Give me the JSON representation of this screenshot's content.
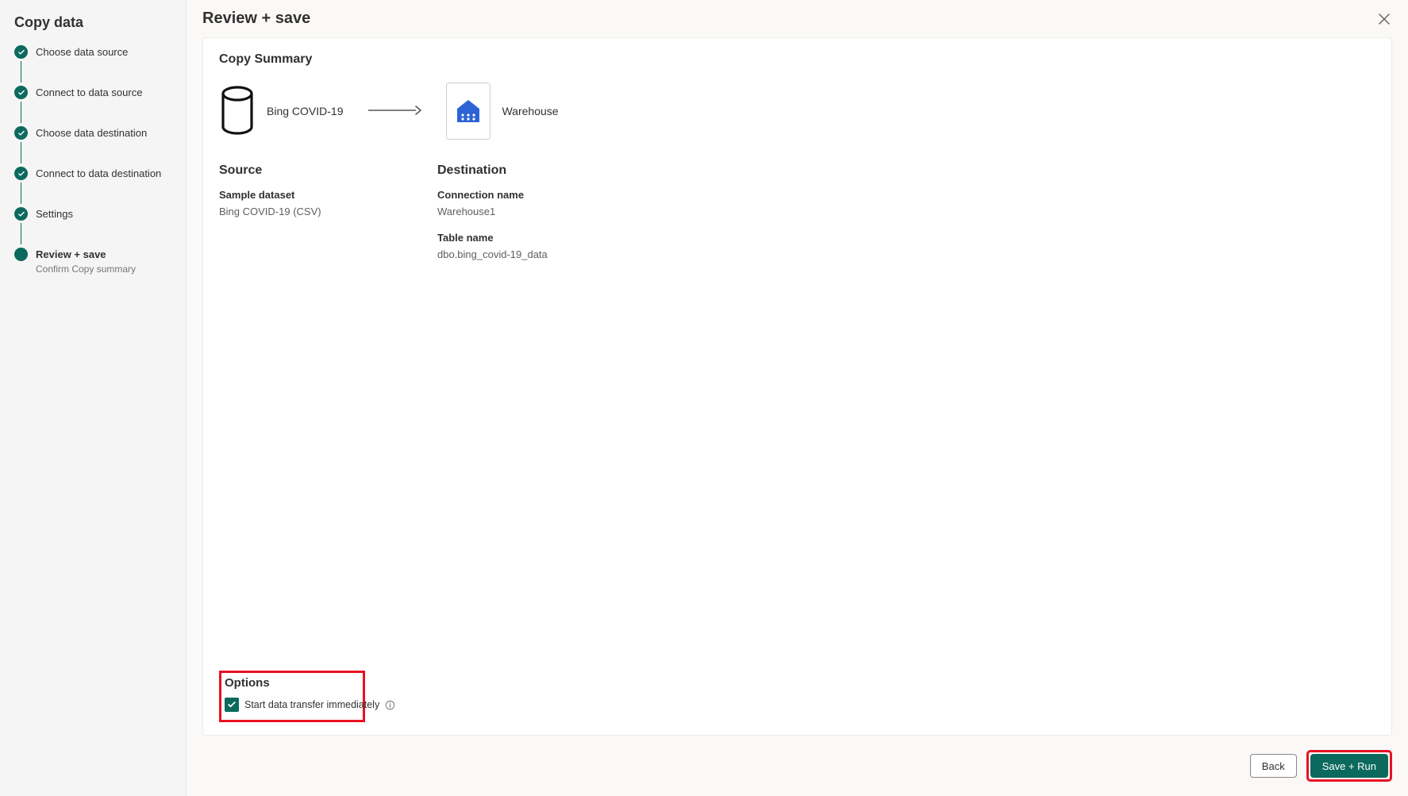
{
  "sidebar": {
    "title": "Copy data",
    "steps": [
      {
        "label": "Choose data source",
        "state": "done"
      },
      {
        "label": "Connect to data source",
        "state": "done"
      },
      {
        "label": "Choose data destination",
        "state": "done"
      },
      {
        "label": "Connect to data destination",
        "state": "done"
      },
      {
        "label": "Settings",
        "state": "done"
      },
      {
        "label": "Review + save",
        "state": "current",
        "sub": "Confirm Copy summary"
      }
    ]
  },
  "header": {
    "title": "Review + save"
  },
  "summary": {
    "section_title": "Copy Summary",
    "source_node_label": "Bing COVID-19",
    "destination_node_label": "Warehouse",
    "source": {
      "heading": "Source",
      "fields": [
        {
          "label": "Sample dataset",
          "value": "Bing COVID-19 (CSV)"
        }
      ]
    },
    "destination": {
      "heading": "Destination",
      "fields": [
        {
          "label": "Connection name",
          "value": "Warehouse1"
        },
        {
          "label": "Table name",
          "value": "dbo.bing_covid-19_data"
        }
      ]
    }
  },
  "options": {
    "heading": "Options",
    "checkbox_label": "Start data transfer immediately",
    "checked": true
  },
  "footer": {
    "back_label": "Back",
    "save_run_label": "Save + Run"
  },
  "colors": {
    "accent": "#0b6a5d",
    "highlight_border": "#e81123",
    "warehouse_icon": "#2c64d6"
  }
}
